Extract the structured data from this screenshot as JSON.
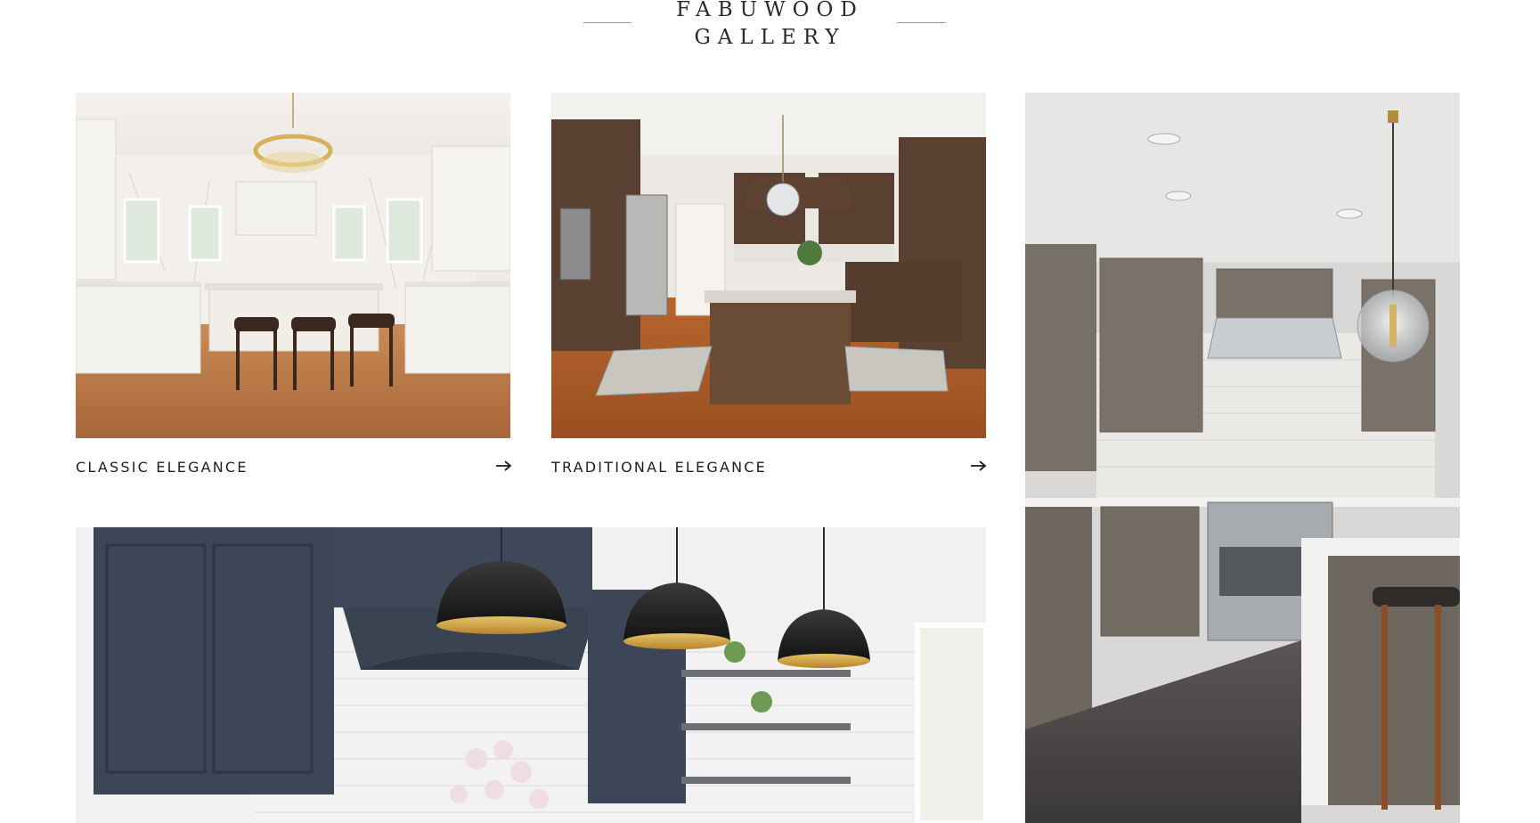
{
  "gallery": {
    "title_line1": "FABUWOOD",
    "title_line2": "GALLERY",
    "cards": [
      {
        "label": "CLASSIC ELEGANCE",
        "arrow_icon": "arrow-right-icon"
      },
      {
        "label": "TRADITIONAL ELEGANCE",
        "arrow_icon": "arrow-right-icon"
      }
    ]
  },
  "colors": {
    "background": "#ffffff",
    "text": "#1d1d1d",
    "rule": "#9a9a9a"
  }
}
